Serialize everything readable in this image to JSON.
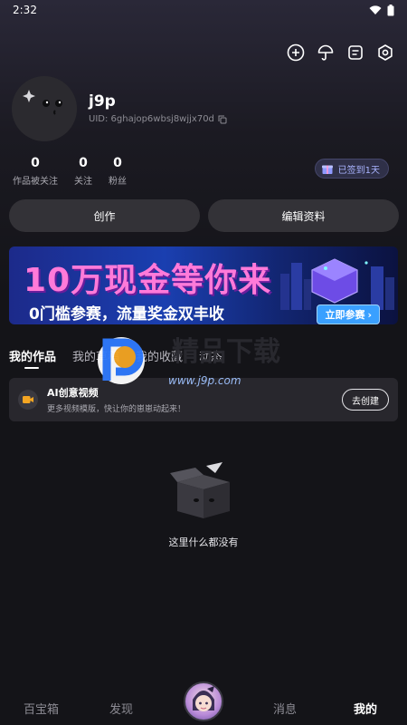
{
  "status_bar": {
    "time": "2:32"
  },
  "profile": {
    "name": "j9p",
    "uid": "UID: 6ghajop6wbsj8wjjx70d",
    "stats": [
      {
        "value": "0",
        "label": "作品被关注"
      },
      {
        "value": "0",
        "label": "关注"
      },
      {
        "value": "0",
        "label": "粉丝"
      }
    ],
    "checkin_label": "已签到1天"
  },
  "actions": {
    "create_label": "创作",
    "edit_label": "编辑资料"
  },
  "banner": {
    "headline": "10万现金等你来",
    "subline": "0门槛参赛，流量奖金双丰收",
    "cta": "立即参赛"
  },
  "tabs": [
    {
      "label": "我的作品"
    },
    {
      "label": "我的草稿"
    },
    {
      "label": "我的收藏"
    },
    {
      "label": "动态"
    }
  ],
  "watermark": {
    "title": "精品下载",
    "url": "www.j9p.com"
  },
  "ai_card": {
    "title": "AI创意视频",
    "desc": "更多视频模版，快让你的崽崽动起来！",
    "button": "去创建"
  },
  "empty_state": {
    "text": "这里什么都没有"
  },
  "bottom_nav": [
    {
      "label": "百宝箱"
    },
    {
      "label": "发现"
    },
    {
      "label": "消息"
    },
    {
      "label": "我的"
    }
  ],
  "colors": {
    "background": "#141418",
    "accent": "#a9b4ff",
    "banner_cta": "#3aa0ff"
  }
}
